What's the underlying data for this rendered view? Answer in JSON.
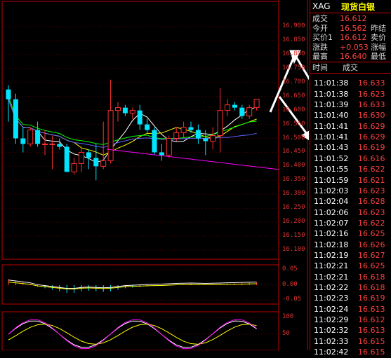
{
  "quote_panel": {
    "symbol": "XAG",
    "name": "现货白银",
    "rows": [
      {
        "label": "成交",
        "value": "16.612",
        "extra": ""
      },
      {
        "label": "今开",
        "value": "16.562",
        "extra": "昨结"
      },
      {
        "label": "买价1",
        "value": "16.612",
        "extra": "卖价"
      },
      {
        "label": "涨跌",
        "value": "+0.053",
        "extra": "涨幅"
      },
      {
        "label": "最高",
        "value": "16.640",
        "extra": "最低"
      }
    ],
    "tick_headers": {
      "time": "时间",
      "price": "成交"
    },
    "ticks": [
      {
        "time": "11:01:38",
        "price": "16.633"
      },
      {
        "time": "11:01:38",
        "price": "16.623"
      },
      {
        "time": "11:01:39",
        "price": "16.633"
      },
      {
        "time": "11:01:40",
        "price": "16.630"
      },
      {
        "time": "11:01:41",
        "price": "16.629"
      },
      {
        "time": "11:01:41",
        "price": "16.629"
      },
      {
        "time": "11:01:43",
        "price": "16.619"
      },
      {
        "time": "11:01:52",
        "price": "16.616"
      },
      {
        "time": "11:01:55",
        "price": "16.622"
      },
      {
        "time": "11:01:59",
        "price": "16.621"
      },
      {
        "time": "11:02:03",
        "price": "16.623"
      },
      {
        "time": "11:02:04",
        "price": "16.628"
      },
      {
        "time": "11:02:06",
        "price": "16.623"
      },
      {
        "time": "11:02:07",
        "price": "16.622"
      },
      {
        "time": "11:02:16",
        "price": "16.625"
      },
      {
        "time": "11:02:18",
        "price": "16.626"
      },
      {
        "time": "11:02:19",
        "price": "16.627"
      },
      {
        "time": "11:02:21",
        "price": "16.625"
      },
      {
        "time": "11:02:21",
        "price": "16.618"
      },
      {
        "time": "11:02:22",
        "price": "16.618"
      },
      {
        "time": "11:02:23",
        "price": "16.619"
      },
      {
        "time": "11:02:24",
        "price": "16.613"
      },
      {
        "time": "11:02:29",
        "price": "16.612"
      },
      {
        "time": "11:02:32",
        "price": "16.613"
      },
      {
        "time": "11:02:33",
        "price": "16.615"
      },
      {
        "time": "11:02:42",
        "price": "16.615"
      }
    ]
  },
  "price_axis": [
    "16.900",
    "16.850",
    "16.800",
    "16.750",
    "16.700",
    "16.650",
    "16.600",
    "16.550",
    "16.500",
    "16.450",
    "16.400",
    "16.350",
    "16.300",
    "16.250",
    "16.200",
    "16.150",
    "16.100"
  ],
  "macd_axis": [
    "0.05",
    "0.00",
    "-0.05"
  ],
  "kdj_axis": [
    "100",
    "50"
  ],
  "colors": {
    "up": "#ff3030",
    "down": "#00e5ff",
    "ma5": "#ffffff",
    "ma10": "#ffff00",
    "ma20": "#ff00ff",
    "ma60": "#00ff00",
    "trend": "#ff00ff"
  },
  "candles": [
    {
      "o": 16.675,
      "h": 16.69,
      "l": 16.56,
      "c": 16.64
    },
    {
      "o": 16.64,
      "h": 16.66,
      "l": 16.48,
      "c": 16.5
    },
    {
      "o": 16.5,
      "h": 16.54,
      "l": 16.45,
      "c": 16.48
    },
    {
      "o": 16.48,
      "h": 16.54,
      "l": 16.47,
      "c": 16.53
    },
    {
      "o": 16.53,
      "h": 16.56,
      "l": 16.47,
      "c": 16.48
    },
    {
      "o": 16.48,
      "h": 16.53,
      "l": 16.44,
      "c": 16.48
    },
    {
      "o": 16.48,
      "h": 16.51,
      "l": 16.39,
      "c": 16.48
    },
    {
      "o": 16.48,
      "h": 16.5,
      "l": 16.46,
      "c": 16.47
    },
    {
      "o": 16.47,
      "h": 16.48,
      "l": 16.38,
      "c": 16.38
    },
    {
      "o": 16.38,
      "h": 16.43,
      "l": 16.37,
      "c": 16.41
    },
    {
      "o": 16.41,
      "h": 16.47,
      "l": 16.38,
      "c": 16.45
    },
    {
      "o": 16.45,
      "h": 16.46,
      "l": 16.39,
      "c": 16.43
    },
    {
      "o": 16.43,
      "h": 16.48,
      "l": 16.35,
      "c": 16.4
    },
    {
      "o": 16.4,
      "h": 16.56,
      "l": 16.39,
      "c": 16.42
    },
    {
      "o": 16.42,
      "h": 16.71,
      "l": 16.41,
      "c": 16.6
    },
    {
      "o": 16.6,
      "h": 16.63,
      "l": 16.56,
      "c": 16.61
    },
    {
      "o": 16.61,
      "h": 16.62,
      "l": 16.58,
      "c": 16.59
    },
    {
      "o": 16.59,
      "h": 16.61,
      "l": 16.57,
      "c": 16.6
    },
    {
      "o": 16.6,
      "h": 16.62,
      "l": 16.53,
      "c": 16.55
    },
    {
      "o": 16.55,
      "h": 16.57,
      "l": 16.52,
      "c": 16.53
    },
    {
      "o": 16.53,
      "h": 16.54,
      "l": 16.44,
      "c": 16.45
    },
    {
      "o": 16.45,
      "h": 16.48,
      "l": 16.42,
      "c": 16.44
    },
    {
      "o": 16.44,
      "h": 16.51,
      "l": 16.43,
      "c": 16.5
    },
    {
      "o": 16.5,
      "h": 16.54,
      "l": 16.49,
      "c": 16.52
    },
    {
      "o": 16.52,
      "h": 16.56,
      "l": 16.5,
      "c": 16.54
    },
    {
      "o": 16.54,
      "h": 16.56,
      "l": 16.52,
      "c": 16.53
    },
    {
      "o": 16.53,
      "h": 16.55,
      "l": 16.48,
      "c": 16.5
    },
    {
      "o": 16.5,
      "h": 16.53,
      "l": 16.44,
      "c": 16.49
    },
    {
      "o": 16.49,
      "h": 16.54,
      "l": 16.46,
      "c": 16.51
    },
    {
      "o": 16.51,
      "h": 16.68,
      "l": 16.45,
      "c": 16.6
    },
    {
      "o": 16.6,
      "h": 16.64,
      "l": 16.58,
      "c": 16.62
    },
    {
      "o": 16.62,
      "h": 16.63,
      "l": 16.6,
      "c": 16.61
    },
    {
      "o": 16.61,
      "h": 16.62,
      "l": 16.57,
      "c": 16.58
    },
    {
      "o": 16.58,
      "h": 16.62,
      "l": 16.57,
      "c": 16.61
    },
    {
      "o": 16.61,
      "h": 16.64,
      "l": 16.6,
      "c": 16.64
    }
  ],
  "macd_bars": [
    0.02,
    0.015,
    0.01,
    0.005,
    -0.005,
    -0.01,
    -0.015,
    -0.02,
    -0.025,
    -0.025,
    -0.02,
    -0.018,
    -0.02,
    -0.022,
    -0.02,
    -0.015,
    -0.01,
    -0.008,
    -0.006,
    -0.004,
    -0.003,
    -0.002,
    0.0,
    0.002,
    0.003,
    0.004,
    0.003,
    0.002,
    0.003,
    0.004,
    0.005,
    0.006,
    0.007,
    0.008,
    0.009
  ]
}
